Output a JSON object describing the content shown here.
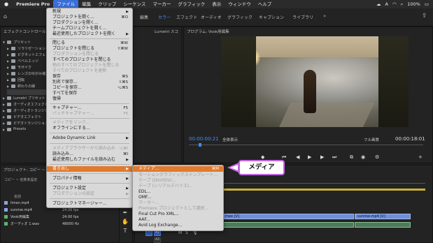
{
  "menubar": {
    "apple": "",
    "app_name": "Premiere Pro",
    "items": [
      "ファイル",
      "編集",
      "クリップ",
      "シーケンス",
      "マーカー",
      "グラフィック",
      "表示",
      "ウィンドウ",
      "ヘルプ"
    ],
    "battery": "100%"
  },
  "workspaces": [
    "編集",
    "カラー",
    "エフェクト",
    "オーディオ",
    "グラフィック",
    "キャプション",
    "ライブラリ"
  ],
  "left_panel": {
    "title": "エフェクトコントロール",
    "items": [
      {
        "label": "プリセット",
        "level": 0
      },
      {
        "label": "ソラリゼーション",
        "level": 1
      },
      {
        "label": "ビグネットエフェクト",
        "level": 1
      },
      {
        "label": "ベベルエッジ",
        "level": 1
      },
      {
        "label": "モザイク",
        "level": 1
      },
      {
        "label": "レンズのゆがみ補正",
        "level": 1
      },
      {
        "label": "回転",
        "level": 1
      },
      {
        "label": "終わりの縁",
        "level": 1
      },
      {
        "label": "Lumetri プリセット",
        "level": 0
      },
      {
        "label": "オーディオエフェクト",
        "level": 0
      },
      {
        "label": "オーディオトランジション",
        "level": 0
      },
      {
        "label": "ビデオエフェクト",
        "level": 0
      },
      {
        "label": "ビデオトランジション",
        "level": 0
      },
      {
        "label": "Presets",
        "level": 0
      }
    ]
  },
  "lumetri_tab": "Lumetri スコ",
  "program_monitor": {
    "title": "プログラム: Vook用編集",
    "timecode": "00:00:00:21",
    "fit_label": "全体表示",
    "quality_label": "フル画質",
    "duration": "00:00:18:01"
  },
  "project_panel": {
    "title": "プロジェクト: コピー ~ 名称",
    "search_placeholder": "コピー ~ 名称未設定",
    "column_name": "名前",
    "rows": [
      {
        "name": "liman.mp4",
        "fps": "",
        "color": "#8aa6e8"
      },
      {
        "name": "sunrise.mp4",
        "fps": "24.00 fps",
        "color": "#8aa6e8"
      },
      {
        "name": "Vook用編集",
        "fps": "24.00 fps",
        "color": "#5fb36c"
      },
      {
        "name": "オーディオ 1.wav",
        "fps": "48000 Hz",
        "color": "#5fb36c"
      }
    ]
  },
  "file_menu": {
    "items": [
      {
        "label": "新規",
        "shortcut": "",
        "submenu": true,
        "disabled": false
      },
      {
        "label": "プロジェクトを開く...",
        "shortcut": "⌘O",
        "submenu": false,
        "disabled": false
      },
      {
        "label": "プロダクションを開く...",
        "shortcut": "",
        "submenu": false,
        "disabled": false
      },
      {
        "label": "チームプロジェクトを開く...",
        "shortcut": "",
        "submenu": false,
        "disabled": false
      },
      {
        "label": "最近使用したプロジェクトを開く",
        "shortcut": "",
        "submenu": true,
        "disabled": false
      },
      {
        "sep": true
      },
      {
        "label": "閉じる",
        "shortcut": "⌘W",
        "submenu": false,
        "disabled": false
      },
      {
        "label": "プロジェクトを閉じる",
        "shortcut": "⇧⌘W",
        "submenu": false,
        "disabled": false
      },
      {
        "label": "プロダクションを閉じる",
        "shortcut": "",
        "submenu": false,
        "disabled": true
      },
      {
        "label": "すべてのプロジェクトを閉じる",
        "shortcut": "",
        "submenu": false,
        "disabled": false
      },
      {
        "label": "他のすべてのプロジェクトを閉じる",
        "shortcut": "",
        "submenu": false,
        "disabled": true
      },
      {
        "label": "すべてのプロジェクトを更新",
        "shortcut": "",
        "submenu": false,
        "disabled": true
      },
      {
        "label": "保存",
        "shortcut": "⌘S",
        "submenu": false,
        "disabled": false
      },
      {
        "label": "別名で保存...",
        "shortcut": "⇧⌘S",
        "submenu": false,
        "disabled": false
      },
      {
        "label": "コピーを保存...",
        "shortcut": "⌥⌘S",
        "submenu": false,
        "disabled": false
      },
      {
        "label": "すべてを保存",
        "shortcut": "",
        "submenu": false,
        "disabled": false
      },
      {
        "label": "復帰",
        "shortcut": "",
        "submenu": false,
        "disabled": false
      },
      {
        "sep": true
      },
      {
        "label": "キャプチャー...",
        "shortcut": "F5",
        "submenu": false,
        "disabled": false
      },
      {
        "label": "バッチキャプチャー...",
        "shortcut": "F6",
        "submenu": false,
        "disabled": true
      },
      {
        "sep": true
      },
      {
        "label": "メディアをリンク...",
        "shortcut": "",
        "submenu": false,
        "disabled": true
      },
      {
        "label": "オフラインにする...",
        "shortcut": "",
        "submenu": false,
        "disabled": false
      },
      {
        "sep": true
      },
      {
        "label": "Adobe Dynamic Link",
        "shortcut": "",
        "submenu": true,
        "disabled": false
      },
      {
        "sep": true
      },
      {
        "label": "メディアブラウザーから読み込み",
        "shortcut": "⌥⌘I",
        "submenu": false,
        "disabled": true
      },
      {
        "label": "読み込み...",
        "shortcut": "⌘I",
        "submenu": false,
        "disabled": false
      },
      {
        "label": "最近使用したファイルを読み込む",
        "shortcut": "",
        "submenu": true,
        "disabled": false
      },
      {
        "sep": true
      },
      {
        "label": "書き出し",
        "shortcut": "",
        "submenu": true,
        "disabled": false,
        "highlight": true
      },
      {
        "sep": true
      },
      {
        "label": "プロパティ情報",
        "shortcut": "",
        "submenu": true,
        "disabled": false
      },
      {
        "sep": true
      },
      {
        "label": "プロジェクト設定",
        "shortcut": "",
        "submenu": true,
        "disabled": false
      },
      {
        "label": "プロダクションの設定",
        "shortcut": "",
        "submenu": true,
        "disabled": true
      },
      {
        "sep": true
      },
      {
        "label": "プロジェクトマネージャー...",
        "shortcut": "",
        "submenu": false,
        "disabled": false
      }
    ]
  },
  "export_submenu": {
    "items": [
      {
        "label": "メディア...",
        "shortcut": "⌘M",
        "disabled": false,
        "highlight": true
      },
      {
        "label": "モーショングラフィックステンプレート...",
        "shortcut": "",
        "disabled": true
      },
      {
        "label": "テープ (DV/HDV)...",
        "shortcut": "",
        "disabled": true
      },
      {
        "label": "テープ (シリアルデバイス)...",
        "shortcut": "",
        "disabled": true
      },
      {
        "label": "EDL...",
        "shortcut": "",
        "disabled": false
      },
      {
        "label": "OMF...",
        "shortcut": "",
        "disabled": false
      },
      {
        "label": "マーカー...",
        "shortcut": "",
        "disabled": true
      },
      {
        "label": "Premiere プロジェクトとして選択...",
        "shortcut": "",
        "disabled": true
      },
      {
        "label": "Final Cut Pro XML...",
        "shortcut": "",
        "disabled": false
      },
      {
        "label": "AAF...",
        "shortcut": "",
        "disabled": false
      },
      {
        "label": "Avid Log Exchange...",
        "shortcut": "",
        "disabled": false
      }
    ]
  },
  "callout": {
    "label": "メディア"
  },
  "timeline": {
    "clips": [
      {
        "label": "mpe [V]",
        "type": "video"
      },
      {
        "label": "sunrise.mp4 [V]",
        "type": "video"
      }
    ],
    "tracks": [
      "V1",
      "A1",
      "A2"
    ]
  }
}
